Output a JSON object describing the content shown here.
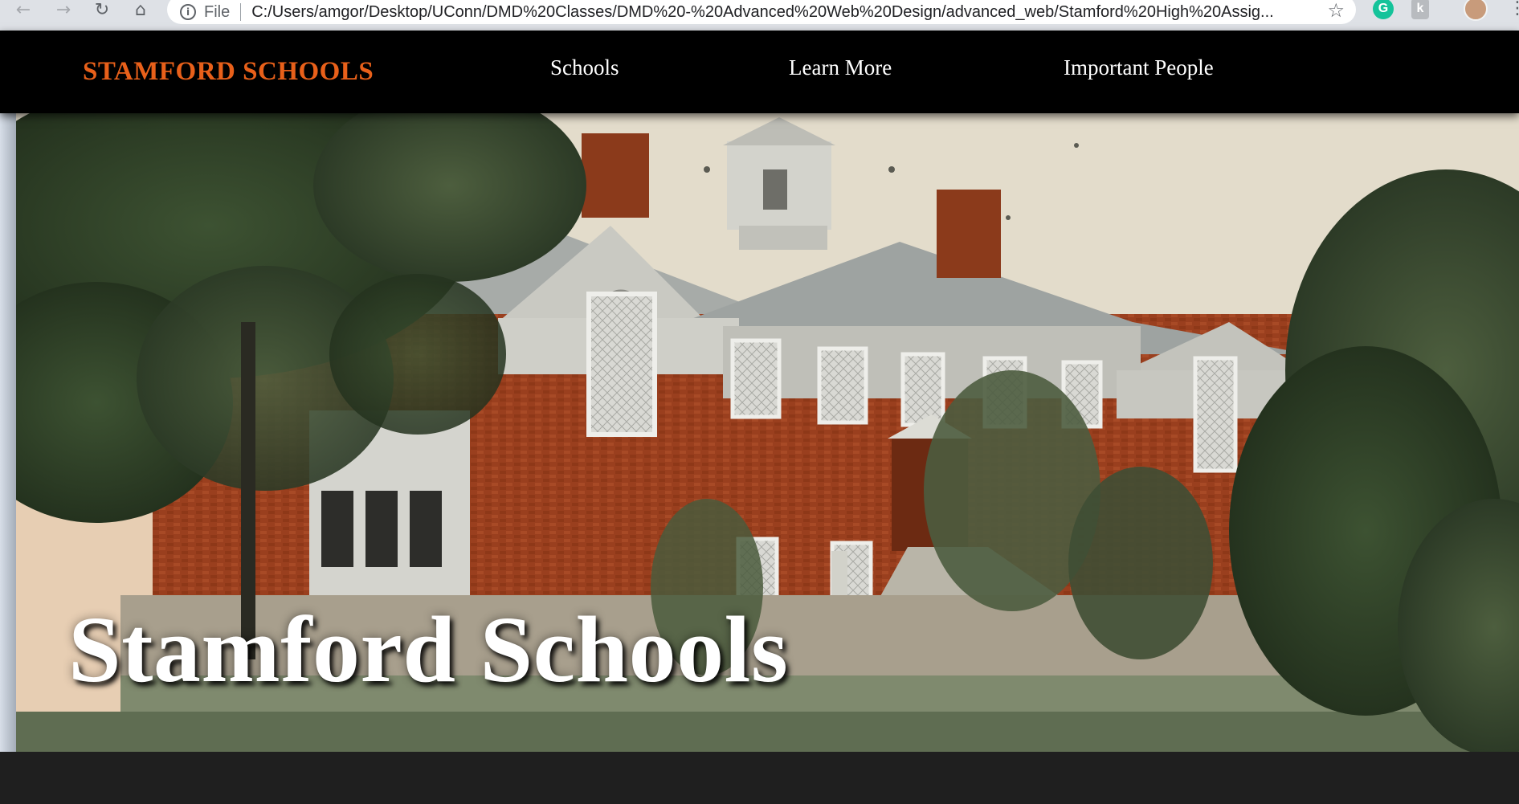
{
  "browser": {
    "url_scheme": "File",
    "url": "C:/Users/amgor/Desktop/UConn/DMD%20Classes/DMD%20-%20Advanced%20Web%20Design/advanced_web/Stamford%20High%20Assig...",
    "icons": {
      "back": "arrow-left-icon",
      "forward": "arrow-right-icon",
      "reload": "reload-icon",
      "home": "home-icon",
      "info": "info-icon",
      "bookmark": "star-icon",
      "grammarly": "grammarly-extension-icon",
      "extension": "extension-icon",
      "profile": "profile-avatar",
      "menu": "more-vert-icon"
    },
    "grammarly_letter": "G",
    "extension_letter": "k"
  },
  "site": {
    "brand": "STAMFORD SCHOOLS",
    "brand_color": "#e8601a",
    "nav": [
      {
        "label": "Schools"
      },
      {
        "label": "Learn More"
      },
      {
        "label": "Important People"
      }
    ],
    "hero_title": "Stamford Schools",
    "hero_image": "historic-brick-school-building-postcard"
  }
}
